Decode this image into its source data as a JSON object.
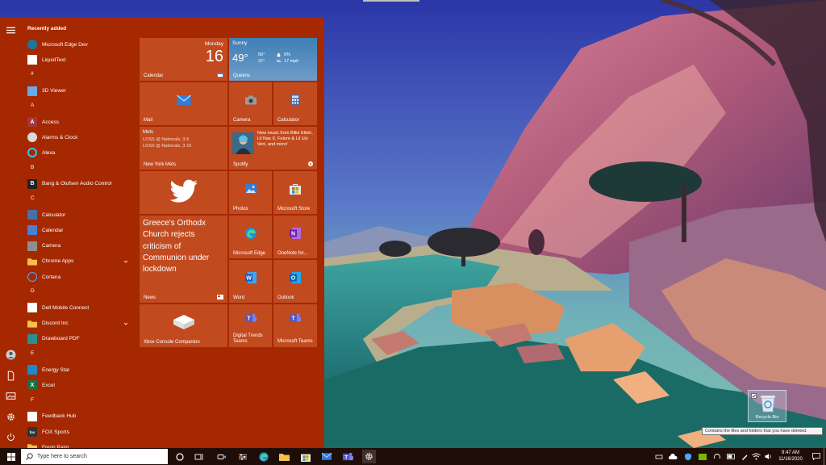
{
  "start_menu": {
    "recently_added": "Recently added",
    "apps": [
      {
        "type": "app",
        "label": "Microsoft Edge Dev",
        "icon": "edge-dev-icon",
        "color": "#1b7a9c"
      },
      {
        "type": "app",
        "label": "LiquidText",
        "icon": "liquidtext-icon",
        "color": "#ffffff"
      },
      {
        "type": "letter",
        "label": "#"
      },
      {
        "type": "app",
        "label": "3D Viewer",
        "icon": "cube-icon",
        "color": "#6aa8e8"
      },
      {
        "type": "letter",
        "label": "A"
      },
      {
        "type": "app",
        "label": "Access",
        "icon": "access-icon",
        "color": "#a4373a"
      },
      {
        "type": "app",
        "label": "Alarms & Clock",
        "icon": "clock-icon",
        "color": "#d9d9d9"
      },
      {
        "type": "app",
        "label": "Alexa",
        "icon": "alexa-icon",
        "color": "#31c4f3"
      },
      {
        "type": "letter",
        "label": "B"
      },
      {
        "type": "app",
        "label": "Bang & Olufsen Audio Control",
        "icon": "bo-icon",
        "color": "#222222"
      },
      {
        "type": "letter",
        "label": "C"
      },
      {
        "type": "app",
        "label": "Calculator",
        "icon": "calculator-icon",
        "color": "#4a6fa5"
      },
      {
        "type": "app",
        "label": "Calendar",
        "icon": "calendar-icon",
        "color": "#4a7fd4"
      },
      {
        "type": "app",
        "label": "Camera",
        "icon": "camera-icon",
        "color": "#8e8e8e"
      },
      {
        "type": "app",
        "label": "Chrome Apps",
        "icon": "folder-icon",
        "color": "#f5c04a",
        "expand": true
      },
      {
        "type": "app",
        "label": "Cortana",
        "icon": "cortana-icon",
        "color": "#4aa8ff"
      },
      {
        "type": "letter",
        "label": "D"
      },
      {
        "type": "app",
        "label": "Dell Mobile Connect",
        "icon": "dell-icon",
        "color": "#ffffff"
      },
      {
        "type": "app",
        "label": "Discord Inc",
        "icon": "folder-icon",
        "color": "#f5c04a",
        "expand": true
      },
      {
        "type": "app",
        "label": "Drawboard PDF",
        "icon": "drawboard-icon",
        "color": "#2a8f8f"
      },
      {
        "type": "letter",
        "label": "E"
      },
      {
        "type": "app",
        "label": "Energy Star",
        "icon": "energy-star-icon",
        "color": "#1e88c9"
      },
      {
        "type": "app",
        "label": "Excel",
        "icon": "excel-icon",
        "color": "#1d6f42"
      },
      {
        "type": "letter",
        "label": "F"
      },
      {
        "type": "app",
        "label": "Feedback Hub",
        "icon": "feedback-icon",
        "color": "#ffffff"
      },
      {
        "type": "app",
        "label": "FOX Sports",
        "icon": "fox-icon",
        "color": "#333333"
      },
      {
        "type": "app",
        "label": "Fresh Paint",
        "icon": "folder-icon",
        "color": "#f5c04a"
      }
    ],
    "tiles": {
      "calendar": {
        "label": "Calendar",
        "day": "Monday",
        "date": "16"
      },
      "weather": {
        "condition": "Sunny",
        "temp": "49°",
        "high": "56°",
        "low": "42°",
        "precip": "0%",
        "wind": "17 mph",
        "city": "Queens"
      },
      "mail": {
        "label": "Mail"
      },
      "camera": {
        "label": "Camera"
      },
      "calculator": {
        "label": "Calculator"
      },
      "mets": {
        "title": "Mets",
        "line1": "LOSS @ Nationals, 3-5",
        "line2": "LOSS @ Nationals, 3-15",
        "label": "New York Mets"
      },
      "spotify": {
        "text": "New music from Billie Eilish, Lil Nas X, Future & Lil Uzi Vert, and more!",
        "label": "Spotify"
      },
      "twitter": {
        "label": ""
      },
      "photos": {
        "label": "Photos"
      },
      "store": {
        "label": "Microsoft Store"
      },
      "news": {
        "headline": "Greece's Orthodx Church rejects criticism of Communion under lockdown",
        "label": "News"
      },
      "edge": {
        "label": "Microsoft Edge"
      },
      "onenote": {
        "label": "OneNote for..."
      },
      "word": {
        "label": "Word"
      },
      "outlook": {
        "label": "Outlook"
      },
      "xbox": {
        "label": "Xbox Console Companion"
      },
      "teams_dt": {
        "label": "Digital Trends Teams"
      },
      "teams_ms": {
        "label": "Microsoft Teams"
      }
    }
  },
  "taskbar": {
    "search_placeholder": "Type here to search",
    "time": "9:47 AM",
    "date": "11/16/2020"
  },
  "desktop": {
    "recycle_bin": "Recycle Bin",
    "tooltip": "Contains the files and folders that you have deleted."
  },
  "colors": {
    "start_bg": "#a52800",
    "tile_bg": "#c24a1f",
    "taskbar": "#1f0e08"
  }
}
